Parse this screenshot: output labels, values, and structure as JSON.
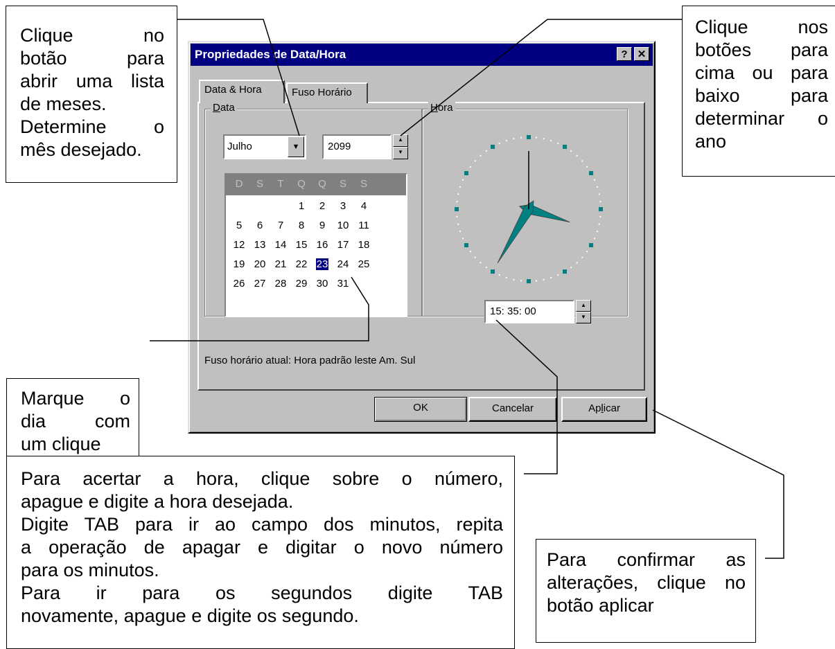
{
  "dialog": {
    "title": "Propriedades de Data/Hora",
    "help_label": "?",
    "close_label": "✕",
    "tabs": [
      "Data & Hora",
      "Fuso Horário"
    ],
    "date_group": {
      "legend_accel": "D",
      "legend_rest": "ata"
    },
    "month": "Julho",
    "year": "2099",
    "calendar": {
      "weekdays": [
        "D",
        "S",
        "T",
        "Q",
        "Q",
        "S",
        "S"
      ],
      "weeks": [
        [
          "",
          "",
          "",
          "1",
          "2",
          "3",
          "4"
        ],
        [
          "5",
          "6",
          "7",
          "8",
          "9",
          "10",
          "11"
        ],
        [
          "12",
          "13",
          "14",
          "15",
          "16",
          "17",
          "18"
        ],
        [
          "19",
          "20",
          "21",
          "22",
          "23",
          "24",
          "25"
        ],
        [
          "26",
          "27",
          "28",
          "29",
          "30",
          "31",
          ""
        ]
      ],
      "selected_day": "23"
    },
    "time_group": {
      "legend_accel": "H",
      "legend_rest": "ora"
    },
    "time": "15: 35: 00",
    "timezone_text": "Fuso horário atual:  Hora padrão leste Am. Sul",
    "buttons": {
      "ok": "OK",
      "cancel": "Cancelar",
      "apply_pre": "Ap",
      "apply_accel": "l",
      "apply_post": "icar"
    }
  },
  "callouts": {
    "month": [
      "Clique no",
      "botão para",
      "abrir uma lista",
      "de meses.",
      "Determine o",
      "mês desejado."
    ],
    "year": [
      "Clique nos",
      "botões para",
      "cima ou para",
      "baixo para",
      "determinar o",
      "ano"
    ],
    "day": [
      "Marque o",
      "dia com",
      "um clique"
    ],
    "time": [
      "Para acertar a hora, clique sobre o número,",
      "apague  e digite a hora desejada.",
      "Digite TAB para ir ao campo dos minutos, repita",
      "a operação de apagar e digitar o novo número",
      "para os minutos.",
      "Para ir para os segundos digite TAB",
      "novamente, apague e digite os segundo."
    ],
    "apply": [
      "Para confirmar as",
      "alterações, clique no",
      "botão aplicar"
    ]
  },
  "colors": {
    "titlebar": "#000080",
    "dialog_face": "#c0c0c0",
    "clock_marker": "#008080"
  }
}
